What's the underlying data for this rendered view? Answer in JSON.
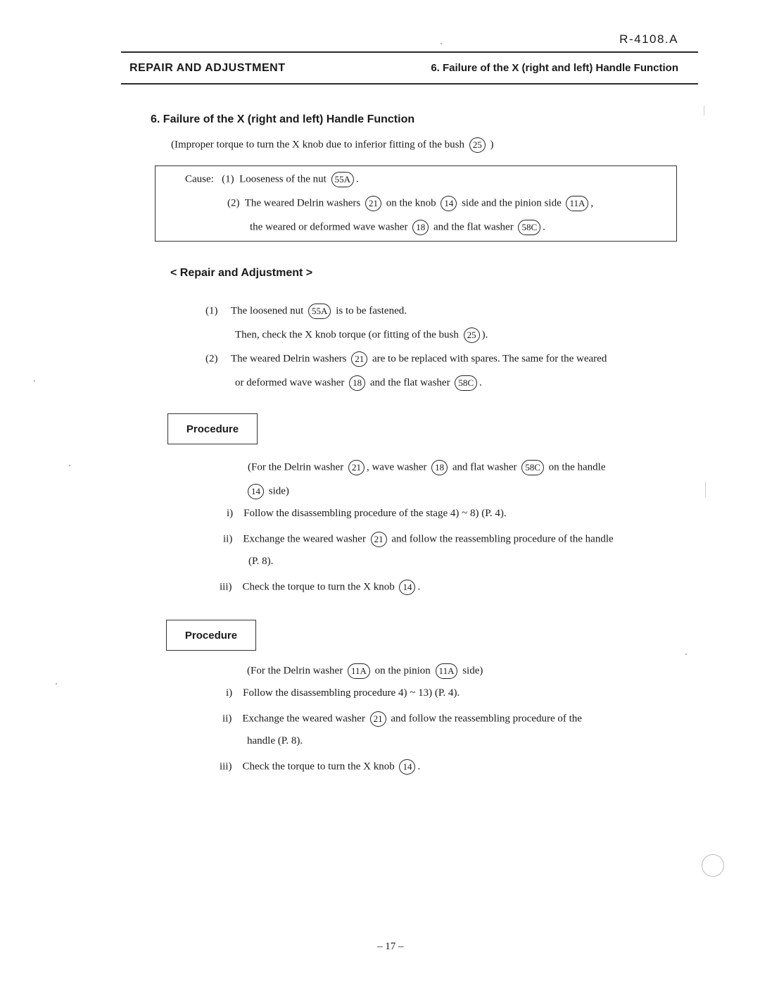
{
  "header": {
    "doc_number": "R-4108.A",
    "left_title": "REPAIR AND ADJUSTMENT",
    "right_title": "6. Failure of the X (right and left) Handle Function"
  },
  "section": {
    "title": "6.   Failure of the X (right and left) Handle Function",
    "subtitle_pre": "(Improper torque to turn the X knob due to inferior fitting of the bush",
    "subtitle_ref": "25",
    "subtitle_post": ")"
  },
  "cause": {
    "label": "Cause:",
    "items": [
      {
        "num": "(1)",
        "pre": "Looseness of the nut",
        "ref1": "55A",
        "post": "."
      },
      {
        "num": "(2)",
        "pre": "The weared Delrin washers",
        "ref1": "21",
        "mid1": "on the knob",
        "ref2": "14",
        "mid2": "side and the pinion side",
        "ref3": "11A",
        "post": ","
      },
      {
        "pre": "the weared or deformed wave washer",
        "ref1": "18",
        "mid1": "and the flat washer",
        "ref2": "58C",
        "post": "."
      }
    ]
  },
  "repair": {
    "heading": "< Repair and Adjustment >",
    "items": [
      {
        "num": "(1)",
        "pre": "The loosened nut",
        "ref1": "55A",
        "post": "is to be fastened."
      },
      {
        "pre": "Then, check the X knob torque (or fitting of the bush",
        "ref1": "25",
        "post": ")."
      },
      {
        "num": "(2)",
        "pre": "The weared Delrin washers",
        "ref1": "21",
        "post": "are to be replaced with spares.  The same for the weared"
      },
      {
        "pre": "or deformed wave washer",
        "ref1": "18",
        "mid1": "and the flat washer",
        "ref2": "58C",
        "post": "."
      }
    ]
  },
  "procedure1": {
    "label": "Procedure",
    "intro_line1": {
      "pre": "(For the Delrin washer",
      "ref1": "21",
      "mid1": ",  wave washer",
      "ref2": "18",
      "mid2": "and flat washer",
      "ref3": "58C",
      "post": "on the handle"
    },
    "intro_line2": {
      "ref1": "14",
      "post": "side)"
    },
    "steps": [
      {
        "num": "i)",
        "text": "Follow the disassembling procedure of the stage 4) ~ 8)  (P. 4)."
      },
      {
        "num": "ii)",
        "pre": "Exchange the weared washer",
        "ref1": "21",
        "post": "and follow the reassembling procedure of the handle"
      },
      {
        "text": "(P. 8)."
      },
      {
        "num": "iii)",
        "pre": "Check the torque to turn the X knob",
        "ref1": "14",
        "post": "."
      }
    ]
  },
  "procedure2": {
    "label": "Procedure",
    "intro_line1": {
      "pre": "(For the Delrin washer",
      "ref1": "11A",
      "mid1": "on the pinion",
      "ref2": "11A",
      "post": "side)"
    },
    "steps": [
      {
        "num": "i)",
        "text": "Follow the disassembling procedure 4) ~ 13)  (P. 4)."
      },
      {
        "num": "ii)",
        "pre": "Exchange the weared washer",
        "ref1": "21",
        "post": "and follow the reassembling procedure of the"
      },
      {
        "text": "handle  (P. 8)."
      },
      {
        "num": "iii)",
        "pre": "Check the torque to turn the X knob",
        "ref1": "14",
        "post": "."
      }
    ]
  },
  "footer": {
    "page_number": "– 17 –"
  }
}
